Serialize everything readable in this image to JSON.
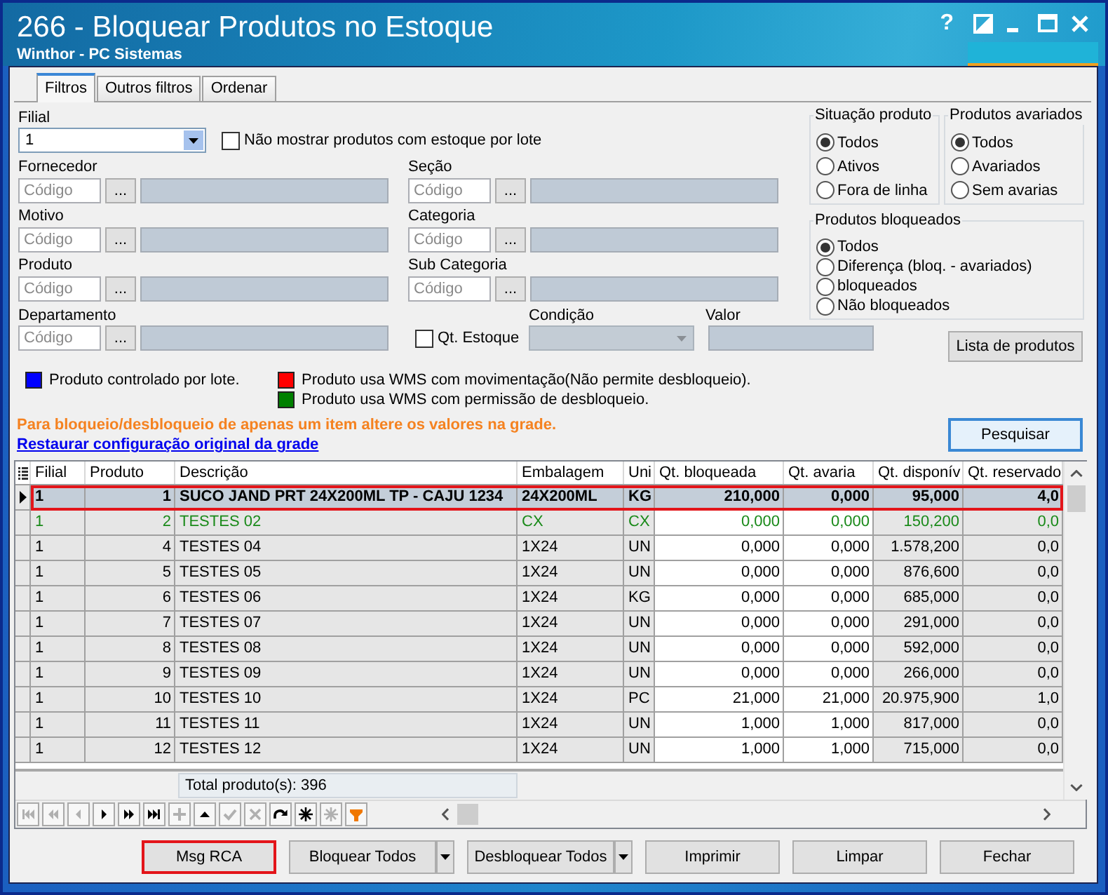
{
  "window": {
    "title": "266 - Bloquear Produtos no Estoque",
    "subtitle": "Winthor - PC Sistemas",
    "help": "?"
  },
  "tabs": [
    {
      "label": "Filtros",
      "selected": true
    },
    {
      "label": "Outros filtros",
      "selected": false
    },
    {
      "label": "Ordenar",
      "selected": false
    }
  ],
  "filters": {
    "filial": {
      "label": "Filial",
      "value": "1"
    },
    "hide_lot_stock": {
      "label": "Não mostrar produtos com estoque por lote",
      "checked": false
    },
    "lookups": [
      {
        "label": "Fornecedor",
        "placeholder": "Código",
        "button": "..."
      },
      {
        "label": "Seção",
        "placeholder": "Código",
        "button": "..."
      },
      {
        "label": "Motivo",
        "placeholder": "Código",
        "button": "..."
      },
      {
        "label": "Categoria",
        "placeholder": "Código",
        "button": "..."
      },
      {
        "label": "Produto",
        "placeholder": "Código",
        "button": "..."
      },
      {
        "label": "Sub Categoria",
        "placeholder": "Código",
        "button": "..."
      }
    ],
    "option_groups": [
      {
        "title": "Situação produto",
        "options": [
          {
            "label": "Todos",
            "selected": true
          },
          {
            "label": "Ativos",
            "selected": false
          },
          {
            "label": "Fora de linha",
            "selected": false
          }
        ]
      },
      {
        "title": "Produtos avariados",
        "options": [
          {
            "label": "Todos",
            "selected": true
          },
          {
            "label": "Avariados",
            "selected": false
          },
          {
            "label": "Sem avarias",
            "selected": false
          }
        ]
      },
      {
        "title": "Produtos bloqueados",
        "options": [
          {
            "label": "Todos",
            "selected": true
          },
          {
            "label": "Diferença (bloq. - avariados)",
            "selected": false
          },
          {
            "label": "bloqueados",
            "selected": false
          },
          {
            "label": "Não bloqueados",
            "selected": false
          }
        ]
      }
    ],
    "department": {
      "label": "Departamento",
      "placeholder": "Código",
      "button": "..."
    },
    "stock_qty": {
      "label": "Qt. Estoque",
      "checked": false
    },
    "condition": {
      "label": "Condição",
      "disabled": true
    },
    "value": {
      "label": "Valor",
      "disabled": true
    },
    "list_button": "Lista de produtos"
  },
  "legend": [
    {
      "items": [
        {
          "label": "Produto controlado por lote.",
          "color": "#0000ff"
        }
      ]
    },
    {
      "items": [
        {
          "label": "Produto usa WMS com movimentação(Não permite desbloqueio).",
          "color": "#ff0000"
        },
        {
          "label": "Produto usa WMS com permissão de desbloqueio.",
          "color": "#008000"
        }
      ]
    }
  ],
  "notice": "Para bloqueio/desbloqueio de apenas um item altere os valores na grade.",
  "restore_link": "Restaurar configuração original da grade",
  "search_button": {
    "label": "Pesquisar",
    "focused": true
  },
  "grid": {
    "columns": [
      {
        "label": "Filial",
        "kind": "text",
        "editable": false
      },
      {
        "label": "Produto",
        "kind": "number",
        "editable": false
      },
      {
        "label": "Descrição",
        "kind": "text",
        "editable": false
      },
      {
        "label": "Embalagem",
        "kind": "text",
        "editable": false
      },
      {
        "label": "Uni",
        "kind": "text",
        "editable": false
      },
      {
        "label": "Qt. bloqueada",
        "kind": "number",
        "editable": true
      },
      {
        "label": "Qt. avaria",
        "kind": "number",
        "editable": true
      },
      {
        "label": "Qt. disponív",
        "kind": "number",
        "editable": false
      },
      {
        "label": "Qt. reservado",
        "kind": "number",
        "editable": false
      }
    ],
    "rows": [
      {
        "selected": true,
        "highlighted": true,
        "color": "#000000",
        "cells": [
          "1",
          "1",
          "SUCO JAND PRT 24X200ML TP - CAJU 1234",
          "24X200ML",
          "KG",
          "210,000",
          "0,000",
          "95,000",
          "4,0"
        ]
      },
      {
        "selected": false,
        "highlighted": false,
        "color": "#1a8a1a",
        "cells": [
          "1",
          "2",
          "TESTES 02",
          "CX",
          "CX",
          "0,000",
          "0,000",
          "150,200",
          "0,0"
        ]
      },
      {
        "selected": false,
        "highlighted": false,
        "color": "#000000",
        "cells": [
          "1",
          "4",
          "TESTES 04",
          "1X24",
          "UN",
          "0,000",
          "0,000",
          "1.578,200",
          "0,0"
        ]
      },
      {
        "selected": false,
        "highlighted": false,
        "color": "#000000",
        "cells": [
          "1",
          "5",
          "TESTES 05",
          "1X24",
          "UN",
          "0,000",
          "0,000",
          "876,600",
          "0,0"
        ]
      },
      {
        "selected": false,
        "highlighted": false,
        "color": "#000000",
        "cells": [
          "1",
          "6",
          "TESTES 06",
          "1X24",
          "KG",
          "0,000",
          "0,000",
          "685,000",
          "0,0"
        ]
      },
      {
        "selected": false,
        "highlighted": false,
        "color": "#000000",
        "cells": [
          "1",
          "7",
          "TESTES 07",
          "1X24",
          "UN",
          "0,000",
          "0,000",
          "291,000",
          "0,0"
        ]
      },
      {
        "selected": false,
        "highlighted": false,
        "color": "#000000",
        "cells": [
          "1",
          "8",
          "TESTES 08",
          "1X24",
          "UN",
          "0,000",
          "0,000",
          "592,000",
          "0,0"
        ]
      },
      {
        "selected": false,
        "highlighted": false,
        "color": "#000000",
        "cells": [
          "1",
          "9",
          "TESTES 09",
          "1X24",
          "UN",
          "0,000",
          "0,000",
          "266,000",
          "0,0"
        ]
      },
      {
        "selected": false,
        "highlighted": false,
        "color": "#000000",
        "cells": [
          "1",
          "10",
          "TESTES 10",
          "1X24",
          "PC",
          "21,000",
          "21,000",
          "20.975,900",
          "1,0"
        ]
      },
      {
        "selected": false,
        "highlighted": false,
        "color": "#000000",
        "cells": [
          "1",
          "11",
          "TESTES 11",
          "1X24",
          "UN",
          "1,000",
          "1,000",
          "817,000",
          "0,0"
        ]
      },
      {
        "selected": false,
        "highlighted": false,
        "color": "#000000",
        "cells": [
          "1",
          "12",
          "TESTES 12",
          "1X24",
          "UN",
          "1,000",
          "1,000",
          "715,000",
          "0,0"
        ]
      }
    ],
    "total": "Total produto(s): 396",
    "navigator": [
      {
        "kind": "first",
        "disabled": true
      },
      {
        "kind": "prior_page",
        "disabled": true
      },
      {
        "kind": "prior",
        "disabled": true
      },
      {
        "kind": "next",
        "disabled": false
      },
      {
        "kind": "next_page",
        "disabled": false
      },
      {
        "kind": "last",
        "disabled": false
      },
      {
        "kind": "insert",
        "disabled": true
      },
      {
        "kind": "edit",
        "disabled": false
      },
      {
        "kind": "post",
        "disabled": true
      },
      {
        "kind": "cancel",
        "disabled": true
      },
      {
        "kind": "refresh",
        "disabled": false
      },
      {
        "kind": "asterisk",
        "disabled": false
      },
      {
        "kind": "asterisk",
        "disabled": true
      },
      {
        "kind": "filter",
        "disabled": false
      }
    ]
  },
  "buttons": [
    {
      "label": "Msg RCA",
      "highlighted": true,
      "dropdown": false
    },
    {
      "label": "Bloquear Todos",
      "highlighted": false,
      "dropdown": true
    },
    {
      "label": "Desbloquear Todos",
      "highlighted": false,
      "dropdown": true
    },
    {
      "label": "Imprimir",
      "highlighted": false,
      "dropdown": false
    },
    {
      "label": "Limpar",
      "highlighted": false,
      "dropdown": false
    },
    {
      "label": "Fechar",
      "highlighted": false,
      "dropdown": false
    }
  ]
}
